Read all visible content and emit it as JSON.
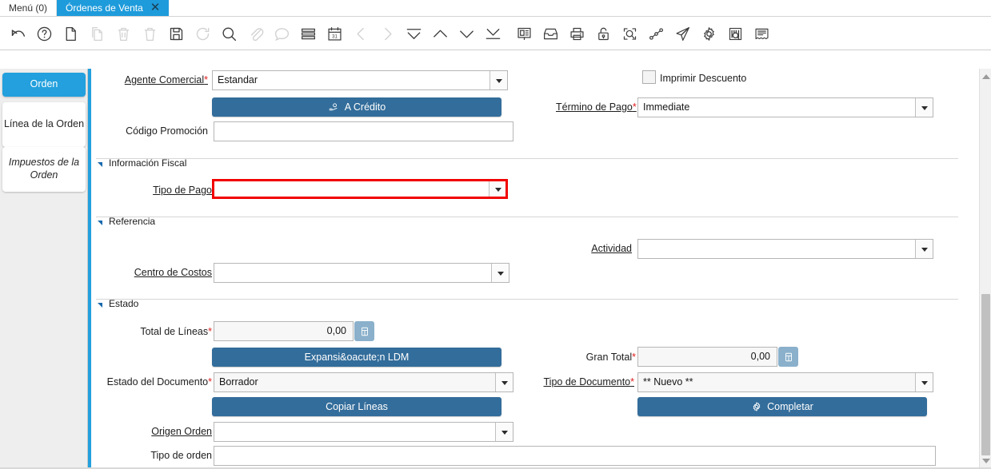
{
  "window": {
    "tabs": [
      {
        "label": "Menú (0)",
        "active": false,
        "closable": false
      },
      {
        "label": "Órdenes de Venta",
        "active": true,
        "closable": true,
        "close_glyph": "✕"
      }
    ]
  },
  "toolbar": {
    "items": [
      {
        "name": "undo-icon",
        "title": "Deshacer",
        "enabled": true
      },
      {
        "name": "help-icon",
        "title": "Ayuda",
        "enabled": true
      },
      {
        "name": "new-record-icon",
        "title": "Nuevo",
        "enabled": true
      },
      {
        "name": "copy-record-icon",
        "title": "Copiar",
        "enabled": false
      },
      {
        "name": "delete-icon",
        "title": "Eliminar",
        "enabled": false
      },
      {
        "name": "delete-all-icon",
        "title": "Eliminar todo",
        "enabled": false
      },
      {
        "name": "save-icon",
        "title": "Guardar",
        "enabled": true
      },
      {
        "name": "refresh-icon",
        "title": "Refrescar",
        "enabled": false
      },
      {
        "name": "search-icon",
        "title": "Buscar",
        "enabled": true
      },
      {
        "name": "attachment-icon",
        "title": "Adjunto",
        "enabled": false
      },
      {
        "name": "chat-icon",
        "title": "Comentarios",
        "enabled": false
      },
      {
        "name": "grid-toggle-icon",
        "title": "Vista de cuadrícula",
        "enabled": true
      },
      {
        "name": "calendar-icon",
        "title": "Calendario",
        "enabled": true
      },
      {
        "name": "previous-record-icon",
        "title": "Anterior",
        "enabled": false
      },
      {
        "name": "next-record-icon",
        "title": "Siguiente",
        "enabled": false
      },
      {
        "name": "first-record-icon",
        "title": "Primero",
        "enabled": true
      },
      {
        "name": "previous-page-icon",
        "title": "Arriba",
        "enabled": true
      },
      {
        "name": "next-page-icon",
        "title": "Abajo",
        "enabled": true
      },
      {
        "name": "last-record-icon",
        "title": "Último",
        "enabled": true
      },
      {
        "name": "report-icon",
        "title": "Reporte",
        "enabled": true
      },
      {
        "name": "archive-icon",
        "title": "Archivo",
        "enabled": true
      },
      {
        "name": "print-icon",
        "title": "Imprimir",
        "enabled": true
      },
      {
        "name": "lock-icon",
        "title": "Bloquear",
        "enabled": true
      },
      {
        "name": "zoom-across-icon",
        "title": "Zoom",
        "enabled": true
      },
      {
        "name": "workflow-icon",
        "title": "Flujo de trabajo",
        "enabled": true
      },
      {
        "name": "send-icon",
        "title": "Enviar",
        "enabled": true
      },
      {
        "name": "settings-icon",
        "title": "Preferencias",
        "enabled": true
      },
      {
        "name": "barcode-icon",
        "title": "Código de barras",
        "enabled": true
      },
      {
        "name": "document-icon",
        "title": "Documento",
        "enabled": true
      }
    ]
  },
  "sidebar": {
    "tabs": [
      {
        "label": "Orden",
        "selected": true
      },
      {
        "label": "Línea de la Orden",
        "selected": false
      },
      {
        "label": "Impuestos de la Orden",
        "selected": false
      }
    ]
  },
  "form": {
    "agente_comercial": {
      "label": "Agente Comercial",
      "required": true,
      "value": "Estandar"
    },
    "a_credito_button": {
      "label": "A Crédito",
      "icon": "hand-coin-icon"
    },
    "codigo_promocion": {
      "label": "Código Promoción",
      "required": false,
      "value": ""
    },
    "imprimir_descuento": {
      "label": "Imprimir Descuento",
      "checked": false
    },
    "termino_de_pago": {
      "label": "Término de Pago",
      "required": true,
      "value": "Immediate"
    },
    "section_fiscal": {
      "title": "Información Fiscal",
      "expanded": true
    },
    "tipo_de_pago": {
      "label": "Tipo de Pago",
      "required": false,
      "value": "",
      "highlight": true,
      "highlight_color": "#f20000"
    },
    "section_referencia": {
      "title": "Referencia",
      "expanded": true
    },
    "actividad": {
      "label": "Actividad",
      "required": false,
      "value": ""
    },
    "centro_de_costos": {
      "label": "Centro de Costos",
      "required": false,
      "value": ""
    },
    "section_estado": {
      "title": "Estado",
      "expanded": true
    },
    "total_de_lineas": {
      "label": "Total de Líneas",
      "required": true,
      "value": "0,00",
      "readonly": true
    },
    "expansion_ldm_button": {
      "label": "Expansi&oacute;n LDM"
    },
    "gran_total": {
      "label": "Gran Total",
      "required": true,
      "value": "0,00",
      "readonly": true
    },
    "estado_del_documento": {
      "label": "Estado del Documento",
      "required": true,
      "value": "Borrador"
    },
    "tipo_de_documento": {
      "label": "Tipo de Documento",
      "required": true,
      "value": "** Nuevo **"
    },
    "copiar_lineas_button": {
      "label": "Copiar Líneas"
    },
    "completar_button": {
      "label": "Completar",
      "icon": "gear-icon"
    },
    "origen_orden": {
      "label": "Origen Orden",
      "required": false,
      "value": ""
    },
    "tipo_de_orden": {
      "label": "Tipo de orden",
      "required": false,
      "value": ""
    },
    "calculator_icon_name": "calculator-icon"
  },
  "colors": {
    "accent_blue": "#23a0dd",
    "button_blue": "#336d9b",
    "error_red": "#f20000",
    "required_red": "#e02020"
  }
}
